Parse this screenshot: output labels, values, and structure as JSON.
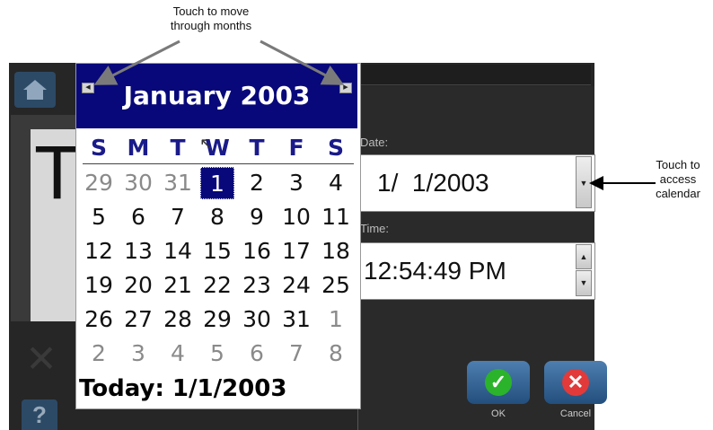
{
  "annotations": {
    "months_hint_line1": "Touch to move",
    "months_hint_line2": "through months",
    "calendar_hint_line1": "Touch to",
    "calendar_hint_line2": "access",
    "calendar_hint_line3": "calendar"
  },
  "calendar": {
    "title": "January 2003",
    "weekdays": [
      "S",
      "M",
      "T",
      "W",
      "T",
      "F",
      "S"
    ],
    "weeks": [
      [
        "29",
        "30",
        "31",
        "1",
        "2",
        "3",
        "4"
      ],
      [
        "5",
        "6",
        "7",
        "8",
        "9",
        "10",
        "11"
      ],
      [
        "12",
        "13",
        "14",
        "15",
        "16",
        "17",
        "18"
      ],
      [
        "19",
        "20",
        "21",
        "22",
        "23",
        "24",
        "25"
      ],
      [
        "26",
        "27",
        "28",
        "29",
        "30",
        "31",
        "1"
      ],
      [
        "2",
        "3",
        "4",
        "5",
        "6",
        "7",
        "8"
      ]
    ],
    "today_label": "Today: 1/1/2003"
  },
  "dialog": {
    "date_label": "Date:",
    "date_value": "1/  1/2003",
    "time_label": "Time:",
    "time_value": "12:54:49 PM",
    "ok_label": "OK",
    "cancel_label": "Cancel"
  },
  "colors": {
    "calendar_header": "#08087a",
    "weekday_text": "#1a1a8a",
    "ok_circle": "#2bb32b",
    "cancel_circle": "#e23a3a"
  }
}
